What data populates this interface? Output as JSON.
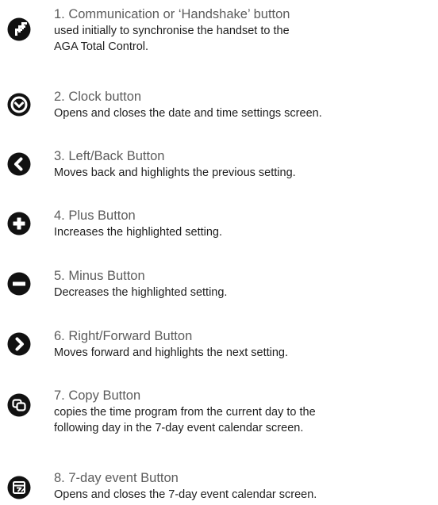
{
  "colors": {
    "icon": "#111111",
    "title_text": "#5c5c5c",
    "desc_text": "#1e1e1e"
  },
  "items": [
    {
      "icon": "handshake-icon",
      "title": "1. Communication or ‘Handshake’ button",
      "desc": [
        "used initially to synchronise the handset to the",
        "AGA Total Control."
      ]
    },
    {
      "icon": "clock-icon",
      "title": "2. Clock button",
      "desc": [
        "Opens and closes the date and time settings screen."
      ]
    },
    {
      "icon": "left-arrow-icon",
      "title": "3. Left/Back Button",
      "desc": [
        "Moves back and highlights the previous setting."
      ]
    },
    {
      "icon": "plus-icon",
      "title": "4. Plus Button",
      "desc": [
        "Increases the highlighted setting."
      ]
    },
    {
      "icon": "minus-icon",
      "title": "5. Minus Button",
      "desc": [
        "Decreases the highlighted setting."
      ]
    },
    {
      "icon": "right-arrow-icon",
      "title": "6. Right/Forward Button",
      "desc": [
        "Moves forward and highlights the next setting."
      ]
    },
    {
      "icon": "copy-icon",
      "title": "7. Copy Button",
      "desc": [
        "copies the time program from the current day to the",
        "following day in the 7-day event calendar screen."
      ]
    },
    {
      "icon": "calendar-icon",
      "title": "8. 7-day event Button",
      "desc": [
        "Opens and closes the 7-day event calendar screen."
      ]
    }
  ]
}
